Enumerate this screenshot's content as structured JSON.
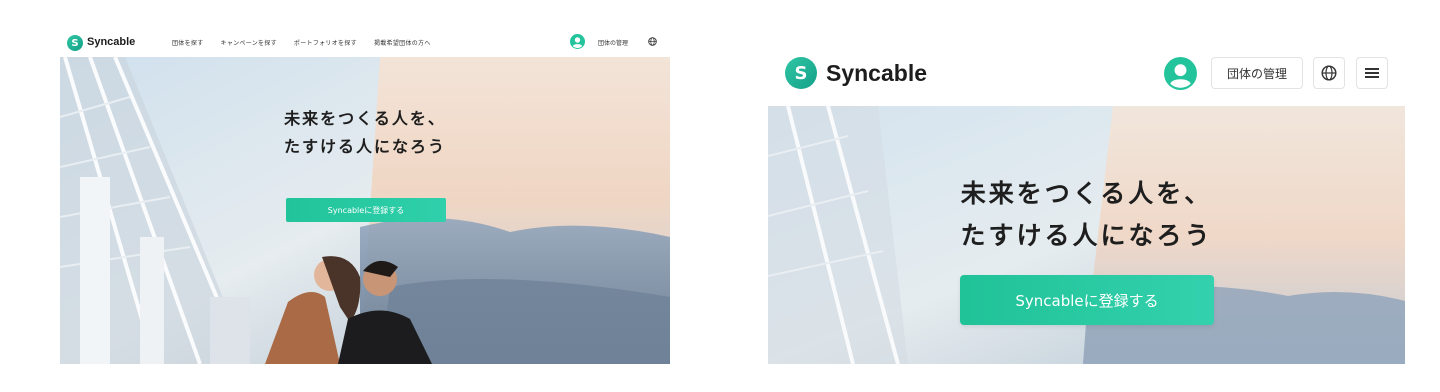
{
  "brand": {
    "name": "Syncable",
    "logo_letter": "S",
    "accent_color": "#23c49c"
  },
  "desktop": {
    "nav": [
      {
        "label": "団体を探す"
      },
      {
        "label": "キャンペーンを探す"
      },
      {
        "label": "ポートフォリオを探す"
      },
      {
        "label": "掲載希望団体の方へ"
      }
    ],
    "manage_label": "団体の管理",
    "hero": {
      "headline_line1": "未来をつくる人を、",
      "headline_line2": "たすける人になろう",
      "cta_label": "Syncableに登録する"
    }
  },
  "mobile": {
    "manage_label": "団体の管理",
    "hero": {
      "headline_line1": "未来をつくる人を、",
      "headline_line2": "たすける人になろう",
      "cta_label": "Syncableに登録する"
    }
  },
  "icons": [
    "user-icon",
    "globe-icon",
    "menu-icon"
  ]
}
